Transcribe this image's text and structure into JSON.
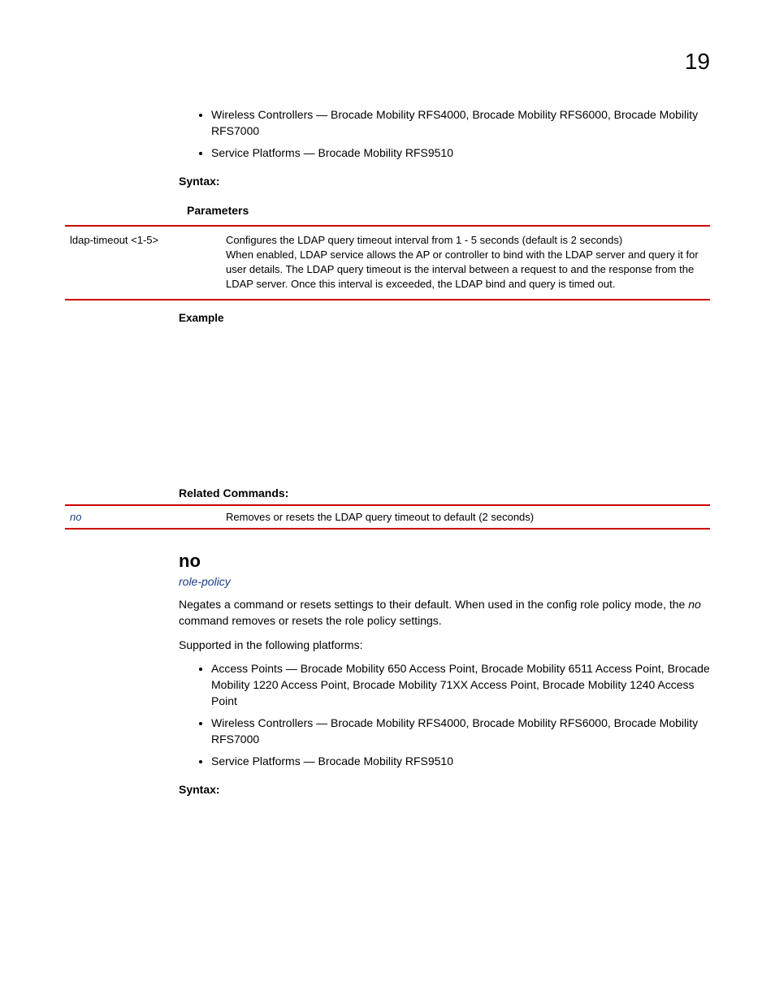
{
  "page_number": "19",
  "top_bullets": [
    "Wireless Controllers — Brocade Mobility RFS4000, Brocade Mobility RFS6000, Brocade Mobility RFS7000",
    "Service Platforms — Brocade Mobility RFS9510"
  ],
  "labels": {
    "syntax": "Syntax:",
    "parameters": "Parameters",
    "example": "Example",
    "related_commands": "Related Commands:"
  },
  "parameters_table": {
    "key": "ldap-timeout <1-5>",
    "line1": "Configures the LDAP query timeout interval from 1 - 5 seconds (default is 2 seconds)",
    "line2": "When enabled, LDAP service allows the AP or controller to bind with the LDAP server and query it for user details. The LDAP query timeout is the interval between a request to and the response from the LDAP server. Once this interval is exceeded, the LDAP bind and query is timed out."
  },
  "related_table": {
    "key": "no",
    "desc": "Removes or resets the LDAP query timeout to default (2 seconds)"
  },
  "no_section": {
    "heading": "no",
    "link": "role-policy",
    "para1_a": "Negates a command or resets settings to their default. When used in the config role policy mode, the ",
    "para1_it": "no",
    "para1_b": " command removes or resets the role policy settings.",
    "para2": "Supported in the following platforms:",
    "bullets": [
      "Access Points — Brocade Mobility 650 Access Point, Brocade Mobility 6511 Access Point, Brocade Mobility 1220 Access Point, Brocade Mobility 71XX Access Point, Brocade Mobility 1240 Access Point",
      "Wireless Controllers — Brocade Mobility RFS4000, Brocade Mobility RFS6000, Brocade Mobility RFS7000",
      "Service Platforms — Brocade Mobility RFS9510"
    ],
    "syntax": "Syntax:"
  }
}
